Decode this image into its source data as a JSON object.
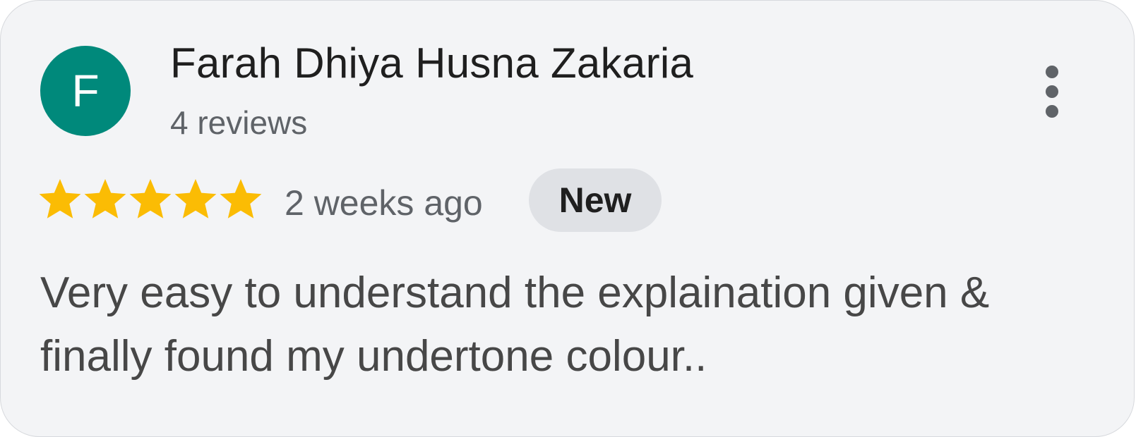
{
  "review": {
    "avatar_letter": "F",
    "avatar_color": "#00897b",
    "author_name": "Farah Dhiya Husna Zakaria",
    "author_meta": "4 reviews",
    "rating": 5,
    "rating_max": 5,
    "star_color": "#fbbc04",
    "time": "2 weeks ago",
    "badge": "New",
    "text_lines": [
      "Very easy to understand the explaination given &",
      "finally found my undertone colour.."
    ]
  },
  "icons": {
    "more": "more-vert-icon",
    "star": "star-icon"
  }
}
